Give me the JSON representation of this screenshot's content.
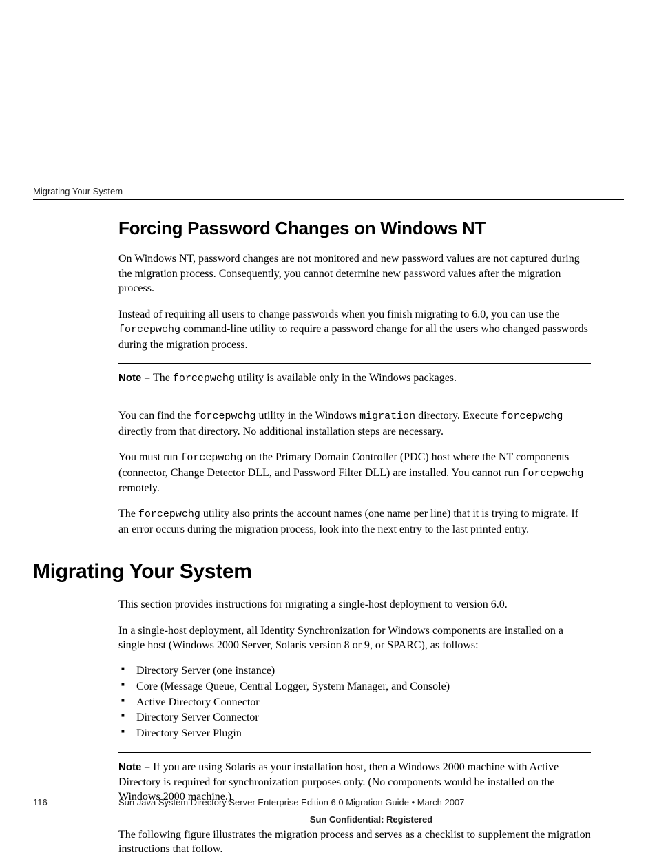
{
  "running_head": "Migrating Your System",
  "section1": {
    "title": "Forcing Password Changes on Windows NT",
    "p1": "On Windows NT, password changes are not monitored and new password values are not captured during the migration process. Consequently, you cannot determine new password values after the migration process.",
    "p2_a": "Instead of requiring all users to change passwords when you finish migrating to 6.0, you can use the ",
    "p2_code": "forcepwchg",
    "p2_b": " command-line utility to require a password change for all the users who changed passwords during the migration process.",
    "note1_label": "Note – ",
    "note1_a": "The ",
    "note1_code": "forcepwchg",
    "note1_b": " utility is available only in the Windows packages.",
    "p3_a": "You can find the ",
    "p3_code1": "forcepwchg",
    "p3_b": " utility in the Windows ",
    "p3_code2": "migration",
    "p3_c": " directory. Execute ",
    "p3_code3": "forcepwchg",
    "p3_d": " directly from that directory. No additional installation steps are necessary.",
    "p4_a": "You must run ",
    "p4_code1": "forcepwchg",
    "p4_b": " on the Primary Domain Controller (PDC) host where the NT components (connector, Change Detector DLL, and Password Filter DLL) are installed. You cannot run ",
    "p4_code2": "forcepwchg",
    "p4_c": " remotely.",
    "p5_a": "The ",
    "p5_code": "forcepwchg",
    "p5_b": " utility also prints the account names (one name per line) that it is trying to migrate. If an error occurs during the migration process, look into the next entry to the last printed entry."
  },
  "section2": {
    "title": "Migrating Your System",
    "p1": "This section provides instructions for migrating a single-host deployment to version 6.0.",
    "p2": "In a single-host deployment, all Identity Synchronization for Windows components are installed on a single host (Windows 2000 Server, Solaris version 8 or 9, or SPARC), as follows:",
    "bullets": [
      "Directory Server (one instance)",
      "Core (Message Queue, Central Logger, System Manager, and Console)",
      "Active Directory Connector",
      "Directory Server Connector",
      "Directory Server Plugin"
    ],
    "note2_label": "Note – ",
    "note2_text": "If you are using Solaris as your installation host, then a Windows 2000 machine with Active Directory is required for synchronization purposes only. (No components would be installed on the Windows 2000 machine.)",
    "p3": "The following figure illustrates the migration process and serves as a checklist to supplement the migration instructions that follow."
  },
  "footer": {
    "page": "116",
    "doc": "Sun Java System Directory Server Enterprise Edition 6.0 Migration Guide • March 2007",
    "confidential": "Sun Confidential: Registered"
  }
}
